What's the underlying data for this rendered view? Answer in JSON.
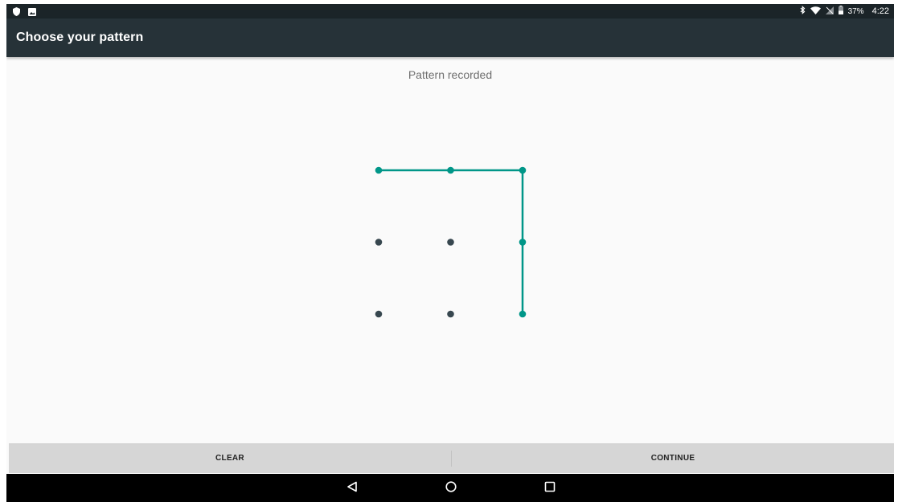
{
  "status_bar": {
    "left_icons": [
      "shield-icon",
      "image-icon"
    ],
    "right_icons": [
      "bluetooth-icon",
      "wifi-icon",
      "no-sim-icon",
      "battery-icon"
    ],
    "battery_text": "37%",
    "time": "4:22"
  },
  "toolbar": {
    "title": "Choose your pattern",
    "background": "#263238"
  },
  "pattern": {
    "header_text": "Pattern recorded",
    "grid": "3x3",
    "selected_sequence": [
      [
        0,
        0
      ],
      [
        0,
        1
      ],
      [
        0,
        2
      ],
      [
        1,
        2
      ],
      [
        2,
        2
      ]
    ],
    "accent_color": "#009688",
    "dot_color": "#37474f"
  },
  "buttons": {
    "clear": "CLEAR",
    "continue": "CONTINUE"
  },
  "nav_bar": {
    "items": [
      "back-icon",
      "home-icon",
      "recents-icon"
    ]
  }
}
